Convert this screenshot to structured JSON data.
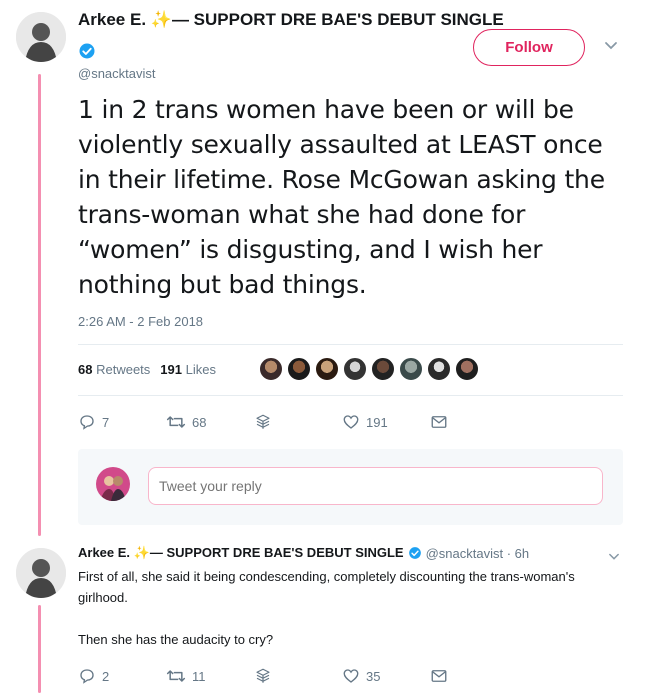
{
  "tweet": {
    "display_name": "Arkee E.",
    "name_suffix": "— SUPPORT DRE BAE'S DEBUT SINGLE",
    "sparkle": "✨",
    "handle": "@snacktavist",
    "follow_label": "Follow",
    "text": "1 in 2 trans women have been or will be violently sexually assaulted at LEAST once in their lifetime. Rose McGowan asking the trans-woman what she had done for “women” is disgusting, and I wish her nothing but bad things.",
    "timestamp": "2:26 AM - 2 Feb 2018",
    "retweets_count": "68",
    "retweets_label": "Retweets",
    "likes_count": "191",
    "likes_label": "Likes",
    "actions": {
      "replies": "7",
      "retweets": "68",
      "likes": "191"
    },
    "reply_placeholder": "Tweet your reply"
  },
  "reply": {
    "display_name": "Arkee E.",
    "name_suffix": "— SUPPORT DRE BAE'S DEBUT SINGLE",
    "sparkle": "✨",
    "handle_time": "@snacktavist · 6h",
    "paragraph_1": "First of all, she said it being condescending, completely discounting the trans-woman's girlhood.",
    "paragraph_2": "Then she has the audacity to cry?",
    "actions": {
      "replies": "2",
      "retweets": "11",
      "likes": "35"
    }
  },
  "colors": {
    "accent": "#e0245e",
    "thread_line": "#f48fb1",
    "verified": "#1da1f2",
    "muted": "#657786"
  },
  "icons": [
    "verified-badge-icon",
    "chevron-down-icon",
    "reply-icon",
    "retweet-icon",
    "stack-icon",
    "heart-icon",
    "mail-icon"
  ]
}
